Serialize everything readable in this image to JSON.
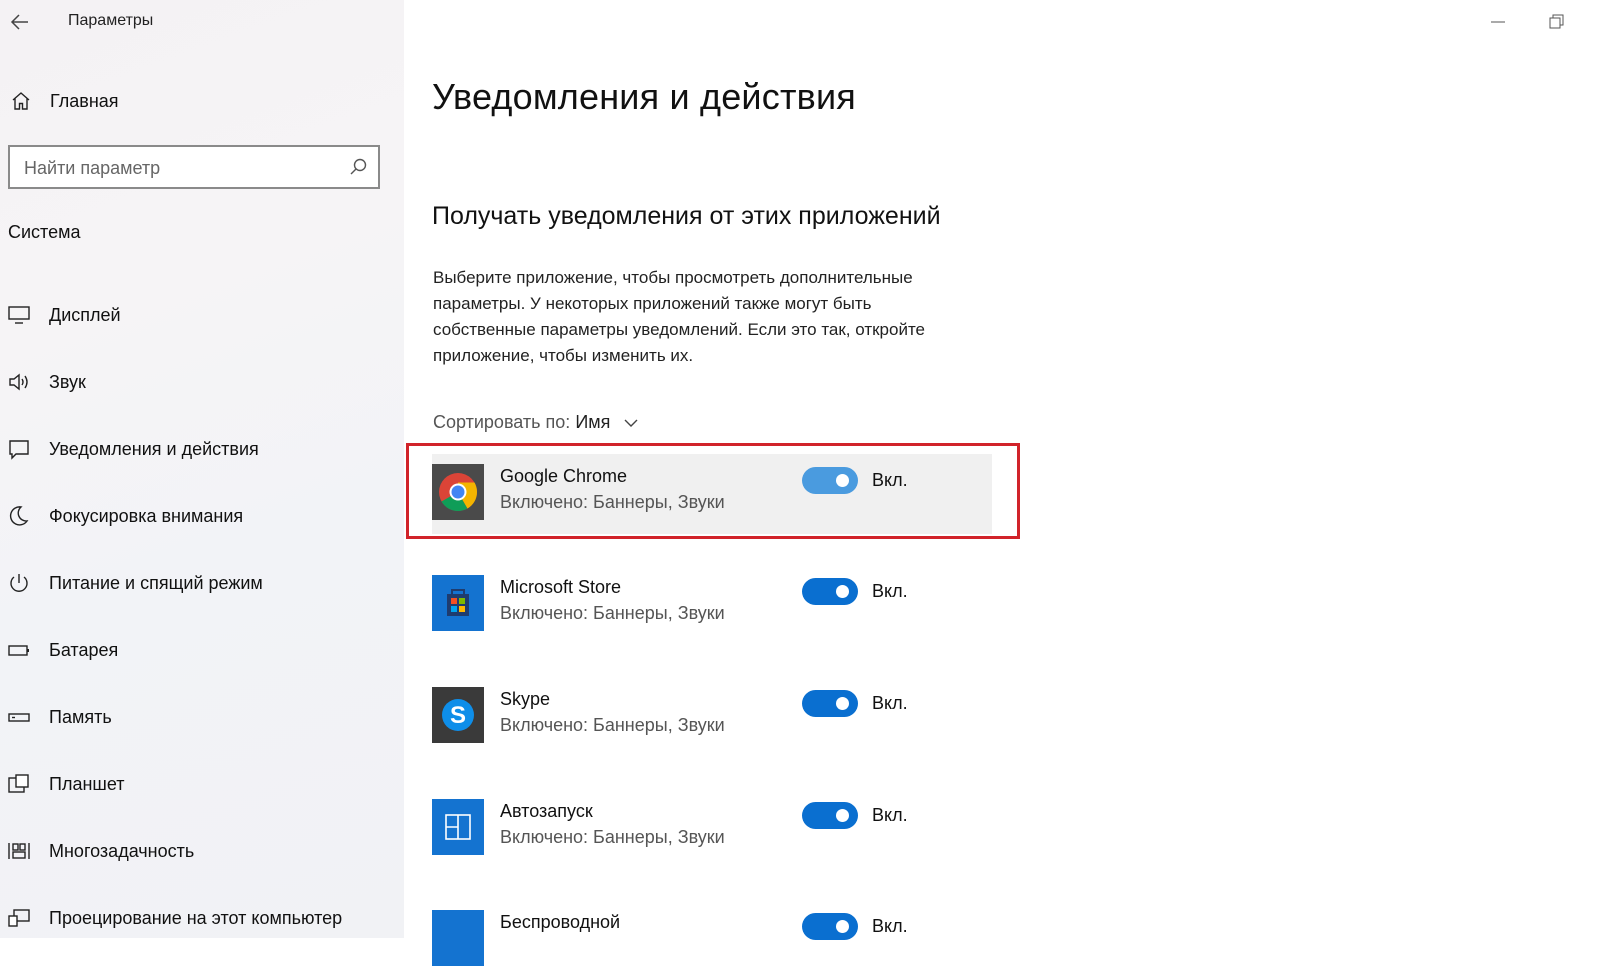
{
  "window": {
    "title": "Параметры",
    "accent_color": "#0a6fd0",
    "highlight_color": "#d1232a"
  },
  "sidebar": {
    "home_label": "Главная",
    "search": {
      "placeholder": "Найти параметр",
      "value": ""
    },
    "section_label": "Система",
    "items": [
      {
        "label": "Дисплей",
        "icon": "monitor-icon"
      },
      {
        "label": "Звук",
        "icon": "speaker-icon"
      },
      {
        "label": "Уведомления и действия",
        "icon": "notification-icon"
      },
      {
        "label": "Фокусировка внимания",
        "icon": "moon-icon"
      },
      {
        "label": "Питание и спящий режим",
        "icon": "power-icon"
      },
      {
        "label": "Батарея",
        "icon": "battery-icon"
      },
      {
        "label": "Память",
        "icon": "storage-icon"
      },
      {
        "label": "Планшет",
        "icon": "tablet-icon"
      },
      {
        "label": "Многозадачность",
        "icon": "multitasking-icon"
      },
      {
        "label": "Проецирование на этот компьютер",
        "icon": "projecting-icon"
      }
    ]
  },
  "main": {
    "page_title": "Уведомления и действия",
    "section_title": "Получать уведомления от этих приложений",
    "description": "Выберите приложение, чтобы просмотреть дополнительные параметры. У некоторых приложений также могут быть собственные параметры уведомлений. Если это так, откройте приложение, чтобы изменить их.",
    "sort": {
      "label": "Сортировать по:",
      "value": "Имя"
    },
    "apps": [
      {
        "name": "Google Chrome",
        "status": "Включено: Баннеры, Звуки",
        "toggle_label": "Вкл.",
        "on": true,
        "icon": "chrome-icon"
      },
      {
        "name": "Microsoft Store",
        "status": "Включено: Баннеры, Звуки",
        "toggle_label": "Вкл.",
        "on": true,
        "icon": "microsoft-store-icon"
      },
      {
        "name": "Skype",
        "status": "Включено: Баннеры, Звуки",
        "toggle_label": "Вкл.",
        "on": true,
        "icon": "skype-icon"
      },
      {
        "name": "Автозапуск",
        "status": "Включено: Баннеры, Звуки",
        "toggle_label": "Вкл.",
        "on": true,
        "icon": "autoplay-icon"
      },
      {
        "name": "Беспроводной",
        "status": "",
        "toggle_label": "Вкл.",
        "on": true,
        "icon": "wireless-icon"
      }
    ]
  }
}
